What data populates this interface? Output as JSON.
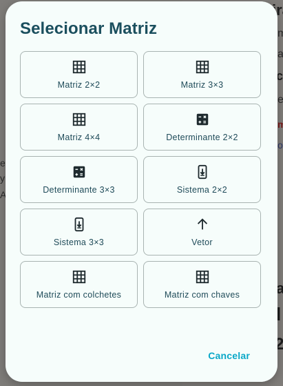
{
  "background": {
    "lines": [
      {
        "text": "ira",
        "cls": "bg-dark"
      },
      {
        "text": "m",
        "cls": ""
      },
      {
        "text": "a",
        "cls": ""
      },
      {
        "text": "ct",
        "cls": "bg-dark"
      },
      {
        "text": "es",
        "cls": ""
      },
      {
        "text": "m",
        "cls": "bg-red"
      },
      {
        "text": "o",
        "cls": "bg-blue"
      },
      {
        "text": "a",
        "cls": "bg-dark"
      },
      {
        "text": "l",
        "cls": "bg-dark"
      },
      {
        "text": "2",
        "cls": "bg-dark"
      }
    ],
    "left_lines": [
      "e",
      "y",
      "A"
    ]
  },
  "dialog": {
    "title": "Selecionar Matriz",
    "options": [
      {
        "label": "Matriz 2×2",
        "icon": "grid-icon"
      },
      {
        "label": "Matriz 3×3",
        "icon": "grid-icon"
      },
      {
        "label": "Matriz 4×4",
        "icon": "grid-icon"
      },
      {
        "label": "Determinante 2×2",
        "icon": "calculator-icon"
      },
      {
        "label": "Determinante 3×3",
        "icon": "calculator-icon"
      },
      {
        "label": "Sistema 2×2",
        "icon": "phone-download-icon"
      },
      {
        "label": "Sistema 3×3",
        "icon": "phone-download-icon"
      },
      {
        "label": "Vetor",
        "icon": "arrow-up-icon"
      },
      {
        "label": "Matriz com colchetes",
        "icon": "grid-icon"
      },
      {
        "label": "Matriz com chaves",
        "icon": "grid-icon"
      }
    ],
    "cancel_label": "Cancelar"
  },
  "colors": {
    "accent": "#0aa8c8",
    "title": "#1b4f5e",
    "dialog_bg": "#f6fdfb"
  }
}
